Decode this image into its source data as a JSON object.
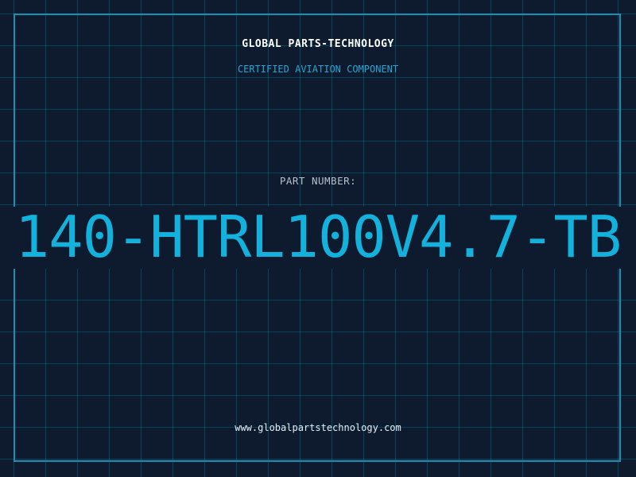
{
  "header": {
    "brand": "GLOBAL PARTS-TECHNOLOGY",
    "subtitle": "CERTIFIED AVIATION COMPONENT"
  },
  "part": {
    "label": "PART NUMBER:",
    "number": "140-HTRL100V4.7-TB"
  },
  "footer": {
    "url": "www.globalpartstechnology.com"
  },
  "colors": {
    "background": "#0e1a2e",
    "grid": "#0088aa",
    "accent": "#13b2dc",
    "frame": "#1093b4"
  }
}
